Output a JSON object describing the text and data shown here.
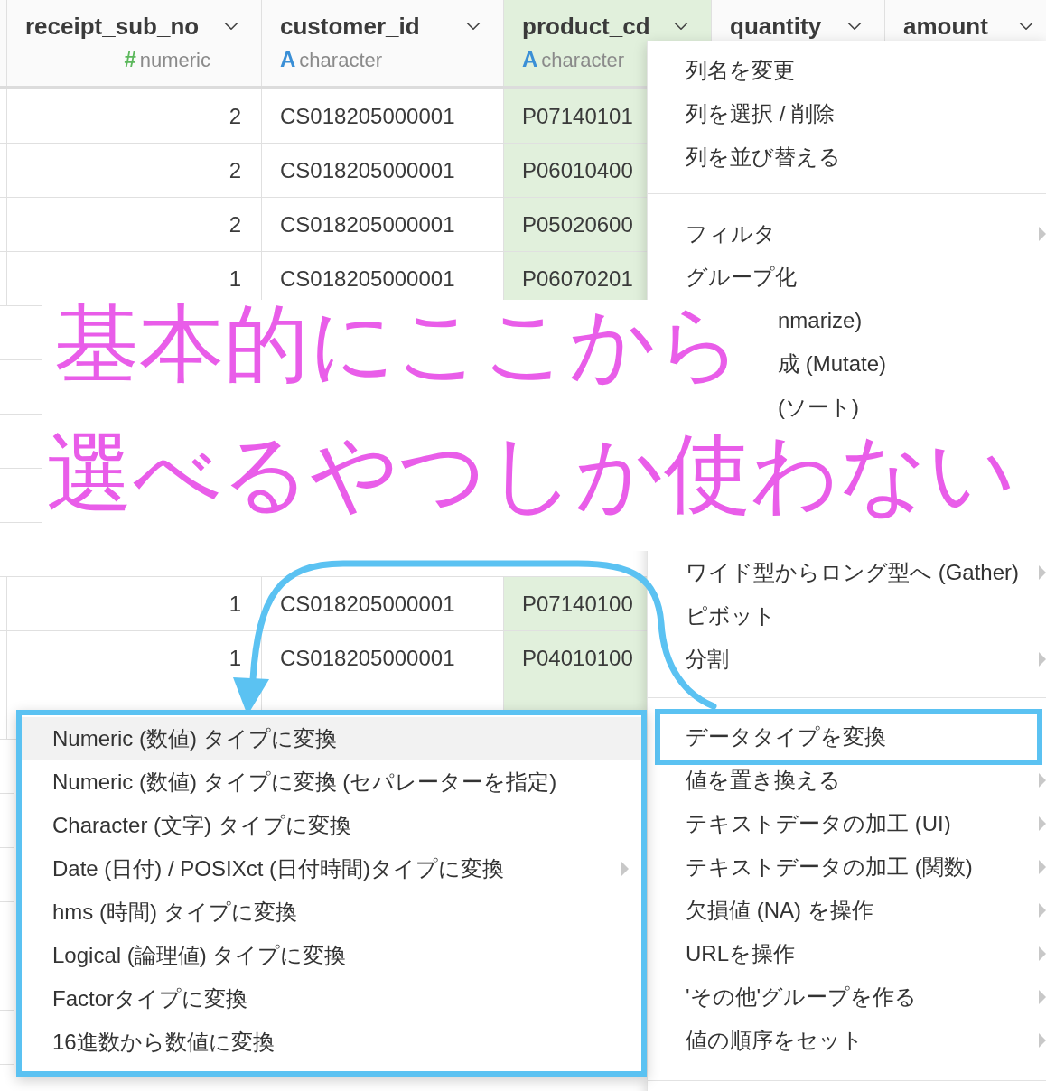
{
  "table": {
    "columns": [
      {
        "name": "receipt_sub_no",
        "type_icon": "#",
        "type": "numeric",
        "kind": "numeric",
        "selected": false
      },
      {
        "name": "customer_id",
        "type_icon": "A",
        "type": "character",
        "kind": "character",
        "selected": false
      },
      {
        "name": "product_cd",
        "type_icon": "A",
        "type": "character",
        "kind": "character",
        "selected": true
      },
      {
        "name": "quantity",
        "selected": false
      },
      {
        "name": "amount",
        "selected": false
      }
    ],
    "rows": [
      {
        "cells": [
          "2",
          "CS018205000001",
          "P07140101"
        ]
      },
      {
        "cells": [
          "2",
          "CS018205000001",
          "P06010400"
        ]
      },
      {
        "cells": [
          "2",
          "CS018205000001",
          "P05020600"
        ]
      },
      {
        "cells": [
          "1",
          "CS018205000001",
          "P06070201"
        ]
      },
      {
        "cells": [
          "1",
          "CS018205000001",
          "P07140100"
        ]
      },
      {
        "cells": [
          "1",
          "CS018205000001",
          "P04010100"
        ]
      }
    ]
  },
  "column_menu": {
    "sections": [
      [
        {
          "label": "列名を変更",
          "submenu": false,
          "annotated": false
        },
        {
          "label": "列を選択 / 削除",
          "submenu": false,
          "annotated": false
        },
        {
          "label": "列を並び替える",
          "submenu": false,
          "annotated": false
        }
      ],
      [
        {
          "label": "フィルタ",
          "submenu": true,
          "annotated": false
        },
        {
          "label": "グループ化",
          "submenu": false,
          "annotated": false
        },
        {
          "label": "nmarize)",
          "kind": "clipped",
          "submenu": false,
          "annotated": false
        },
        {
          "label": "成 (Mutate)",
          "kind": "clipped",
          "submenu": false,
          "annotated": false
        },
        {
          "label": "(ソート)",
          "kind": "clipped",
          "submenu": false,
          "annotated": false
        }
      ],
      [
        {
          "label": "ワイド型からロング型へ (Gather)",
          "submenu": true,
          "annotated": false
        },
        {
          "label": "ピボット",
          "submenu": false,
          "annotated": false
        },
        {
          "label": "分割",
          "submenu": true,
          "annotated": false
        }
      ],
      [
        {
          "label": "データタイプを変換",
          "submenu": false,
          "annotated": true
        },
        {
          "label": "値を置き換える",
          "submenu": true,
          "annotated": false
        },
        {
          "label": "テキストデータの加工 (UI)",
          "submenu": true,
          "annotated": false
        },
        {
          "label": "テキストデータの加工 (関数)",
          "submenu": true,
          "annotated": false
        },
        {
          "label": "欠損値 (NA) を操作",
          "submenu": true,
          "annotated": false
        },
        {
          "label": "URLを操作",
          "submenu": true,
          "annotated": false
        },
        {
          "label": "'その他'グループを作る",
          "submenu": true,
          "annotated": false
        },
        {
          "label": "値の順序をセット",
          "submenu": true,
          "annotated": false
        }
      ]
    ]
  },
  "type_submenu": {
    "items": [
      {
        "label": "Numeric (数値) タイプに変換",
        "highlighted": true,
        "submenu": false
      },
      {
        "label": "Numeric (数値) タイプに変換 (セパレーターを指定)",
        "highlighted": false,
        "submenu": false
      },
      {
        "label": "Character (文字) タイプに変換",
        "highlighted": false,
        "submenu": false
      },
      {
        "label": "Date (日付) / POSIXct (日付時間)タイプに変換",
        "highlighted": false,
        "submenu": true
      },
      {
        "label": "hms (時間) タイプに変換",
        "highlighted": false,
        "submenu": false
      },
      {
        "label": "Logical (論理値) タイプに変換",
        "highlighted": false,
        "submenu": false
      },
      {
        "label": "Factorタイプに変換",
        "highlighted": false,
        "submenu": false
      },
      {
        "label": "16進数から数値に変換",
        "highlighted": false,
        "submenu": false
      }
    ]
  },
  "annotation": {
    "lines": [
      "基本的にここから",
      "選べるやつしか使わない"
    ]
  }
}
